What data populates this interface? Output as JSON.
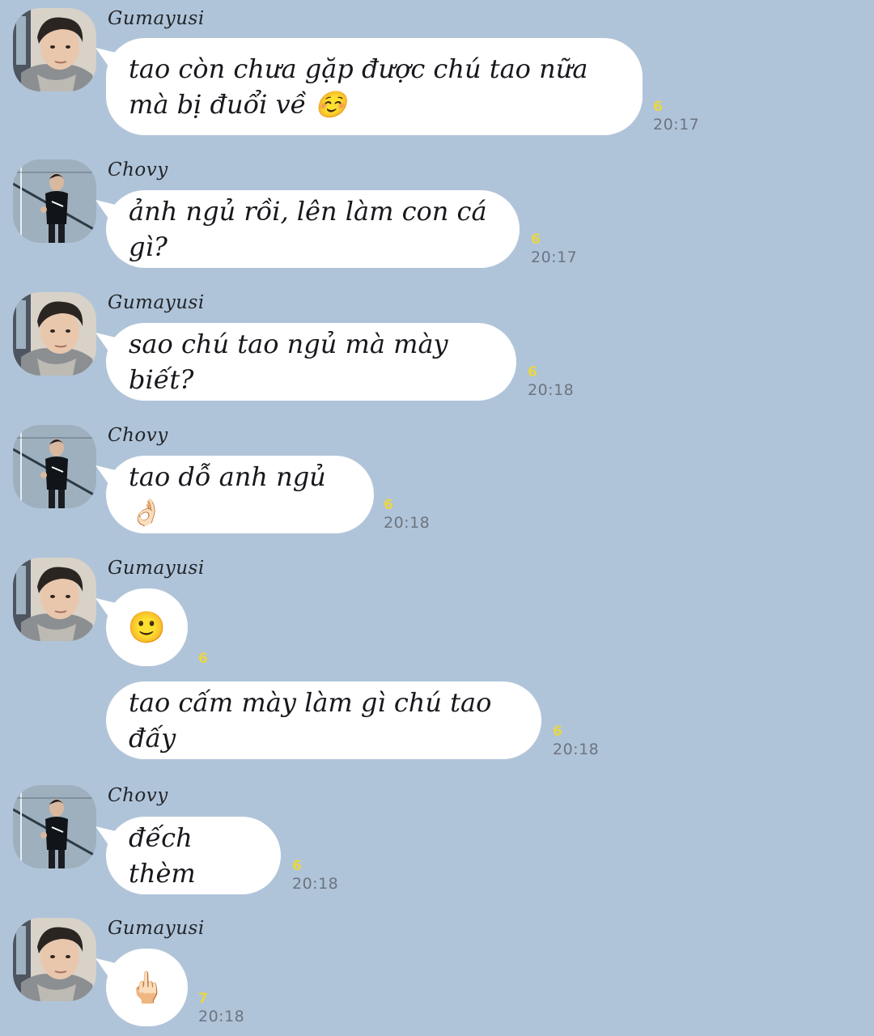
{
  "app": {
    "background_color": "#b0c4d9",
    "bubble_color": "#ffffff",
    "read_color": "#e9d641"
  },
  "participants": {
    "gumayusi": {
      "name": "Gumayusi",
      "avatar": "gumayusi-avatar"
    },
    "chovy": {
      "name": "Chovy",
      "avatar": "chovy-avatar"
    }
  },
  "messages": [
    {
      "sender": "Gumayusi",
      "text": "tao còn chưa gặp được chú tao nữa mà bị đuổi về ☺️",
      "read": "6",
      "time": "20:17"
    },
    {
      "sender": "Chovy",
      "text": "ảnh ngủ rồi, lên làm con cá gì?",
      "read": "6",
      "time": "20:17"
    },
    {
      "sender": "Gumayusi",
      "text": "sao chú tao ngủ mà mày biết?",
      "read": "6",
      "time": "20:18"
    },
    {
      "sender": "Chovy",
      "text": "tao dỗ anh ngủ 👌🏻",
      "read": "6",
      "time": "20:18"
    },
    {
      "sender": "Gumayusi",
      "text": "🙂",
      "read": "6",
      "time": ""
    },
    {
      "sender": "",
      "text": "tao cấm mày làm gì chú tao đấy",
      "read": "6",
      "time": "20:18"
    },
    {
      "sender": "Chovy",
      "text": "đếch thèm",
      "read": "6",
      "time": "20:18"
    },
    {
      "sender": "Gumayusi",
      "text": "🖕🏻",
      "read": "7",
      "time": "20:18"
    }
  ]
}
